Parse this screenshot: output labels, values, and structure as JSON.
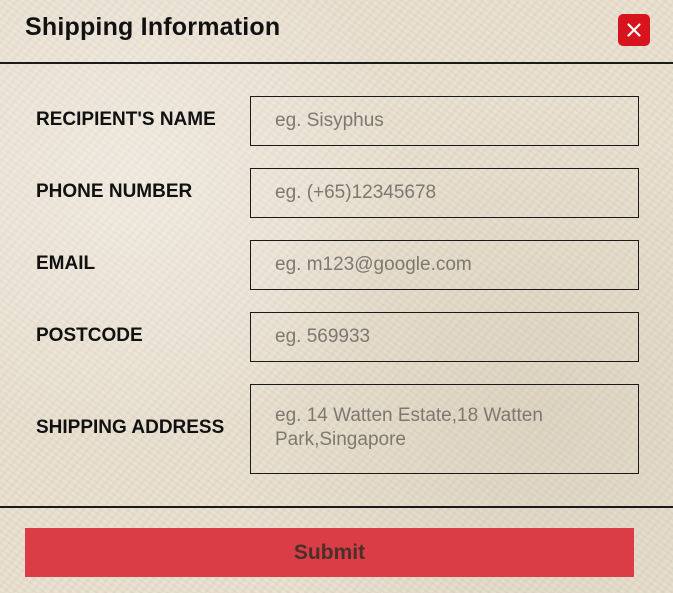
{
  "dialog": {
    "title": "Shipping Information",
    "close_icon": "close-icon",
    "accent_color": "#d7141d"
  },
  "form": {
    "fields": [
      {
        "label": "RECIPIENT'S NAME",
        "placeholder": "eg. Sisyphus",
        "value": ""
      },
      {
        "label": "PHONE NUMBER",
        "placeholder": "eg. (+65)12345678",
        "value": ""
      },
      {
        "label": "EMAIL",
        "placeholder": "eg. m123@google.com",
        "value": ""
      },
      {
        "label": "POSTCODE",
        "placeholder": "eg. 569933",
        "value": ""
      },
      {
        "label": "SHIPPING ADDRESS",
        "placeholder": "eg. 14 Watten Estate,18 Watten Park,Singapore",
        "value": ""
      }
    ]
  },
  "footer": {
    "submit_label": "Submit",
    "submit_color": "#da3d45"
  }
}
